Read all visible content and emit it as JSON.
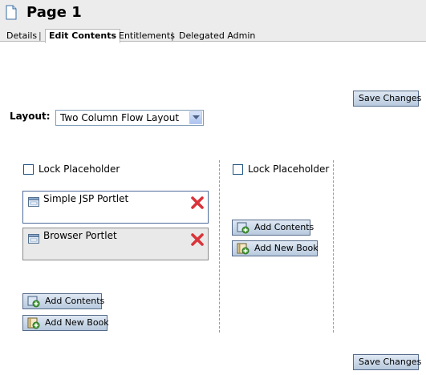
{
  "page": {
    "title": "Page 1"
  },
  "tabs": [
    {
      "label": "Details",
      "active": false
    },
    {
      "label": "Edit Contents",
      "active": true
    },
    {
      "label": "Entitlements",
      "active": false
    },
    {
      "label": "Delegated Admin",
      "active": false
    }
  ],
  "tab_separator": "|",
  "buttons": {
    "save_changes": "Save Changes",
    "add_contents": "Add Contents",
    "add_new_book": "Add New Book"
  },
  "layout": {
    "label": "Layout:",
    "selected": "Two Column Flow Layout"
  },
  "columns": [
    {
      "lock_label": "Lock Placeholder",
      "lock_checked": false,
      "portlets": [
        {
          "title": "Simple JSP Portlet",
          "icon": "portlet-icon",
          "action_icon": "remove-icon"
        },
        {
          "title": "Browser Portlet",
          "icon": "portlet-icon",
          "action_icon": "remove-icon"
        }
      ]
    },
    {
      "lock_label": "Lock Placeholder",
      "lock_checked": false,
      "portlets": []
    }
  ],
  "colors": {
    "header_bg": "#ececec",
    "button_border": "#556b8a",
    "close_red": "#d9343a"
  }
}
